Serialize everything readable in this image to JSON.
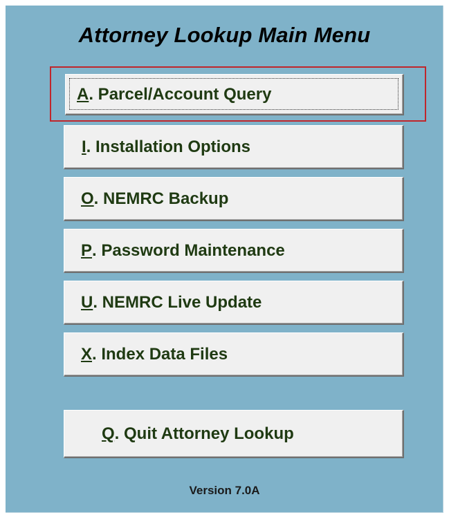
{
  "title": "Attorney Lookup Main Menu",
  "menu": [
    {
      "key": "A",
      "label": ". Parcel/Account Query"
    },
    {
      "key": "I",
      "label": ". Installation Options"
    },
    {
      "key": "O",
      "label": ". NEMRC Backup"
    },
    {
      "key": "P",
      "label": ". Password Maintenance"
    },
    {
      "key": "U",
      "label": ". NEMRC Live Update"
    },
    {
      "key": "X",
      "label": ". Index Data Files"
    },
    {
      "key": "Q",
      "label": ". Quit Attorney Lookup"
    }
  ],
  "version": "Version 7.0A",
  "colors": {
    "panel": "#7fb2c9",
    "button_text": "#1f3a12",
    "focus_ring": "#c0262b"
  }
}
